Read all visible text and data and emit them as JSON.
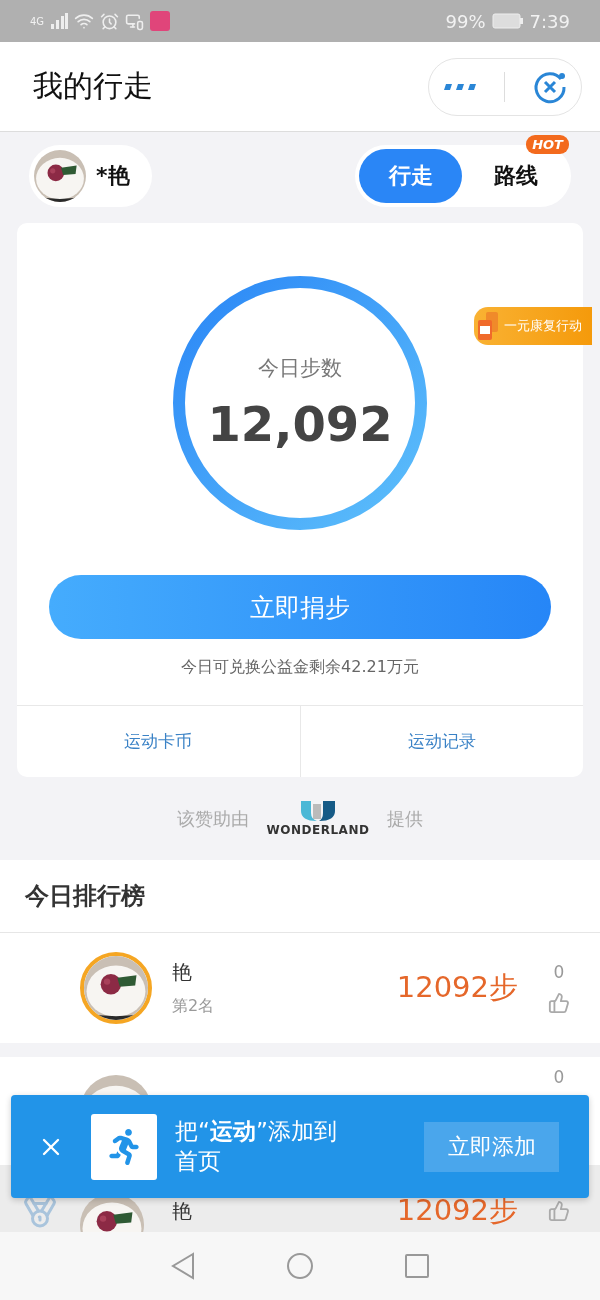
{
  "status_bar": {
    "network": "4G",
    "battery": "99%",
    "time": "7:39"
  },
  "header": {
    "title": "我的行走"
  },
  "user": {
    "name": "*艳"
  },
  "tabs": [
    {
      "label": "行走",
      "selected": true
    },
    {
      "label": "路线",
      "selected": false,
      "badge": "HOT"
    }
  ],
  "today": {
    "label": "今日步数",
    "steps": "12,092",
    "donate_button": "立即捐步",
    "note": "今日可兑换公益金剩余42.21万元",
    "links": [
      "运动卡币",
      "运动记录"
    ]
  },
  "promo": {
    "label": "一元康复行动"
  },
  "sponsor": {
    "prefix": "该赞助由",
    "brand": "WONDERLAND",
    "suffix": "提供"
  },
  "leaderboard": {
    "title": "今日排行榜",
    "rows": [
      {
        "name": "艳",
        "rank": "第2名",
        "steps": "12092步",
        "likes": "0",
        "mine": true,
        "medal": false
      },
      {
        "likes": "0",
        "mine": false,
        "medal": false
      },
      {
        "name": "艳",
        "steps": "12092步",
        "mine": false,
        "medal": true
      }
    ]
  },
  "banner": {
    "text": "把“**运动**”添加到首页",
    "button": "立即添加"
  }
}
